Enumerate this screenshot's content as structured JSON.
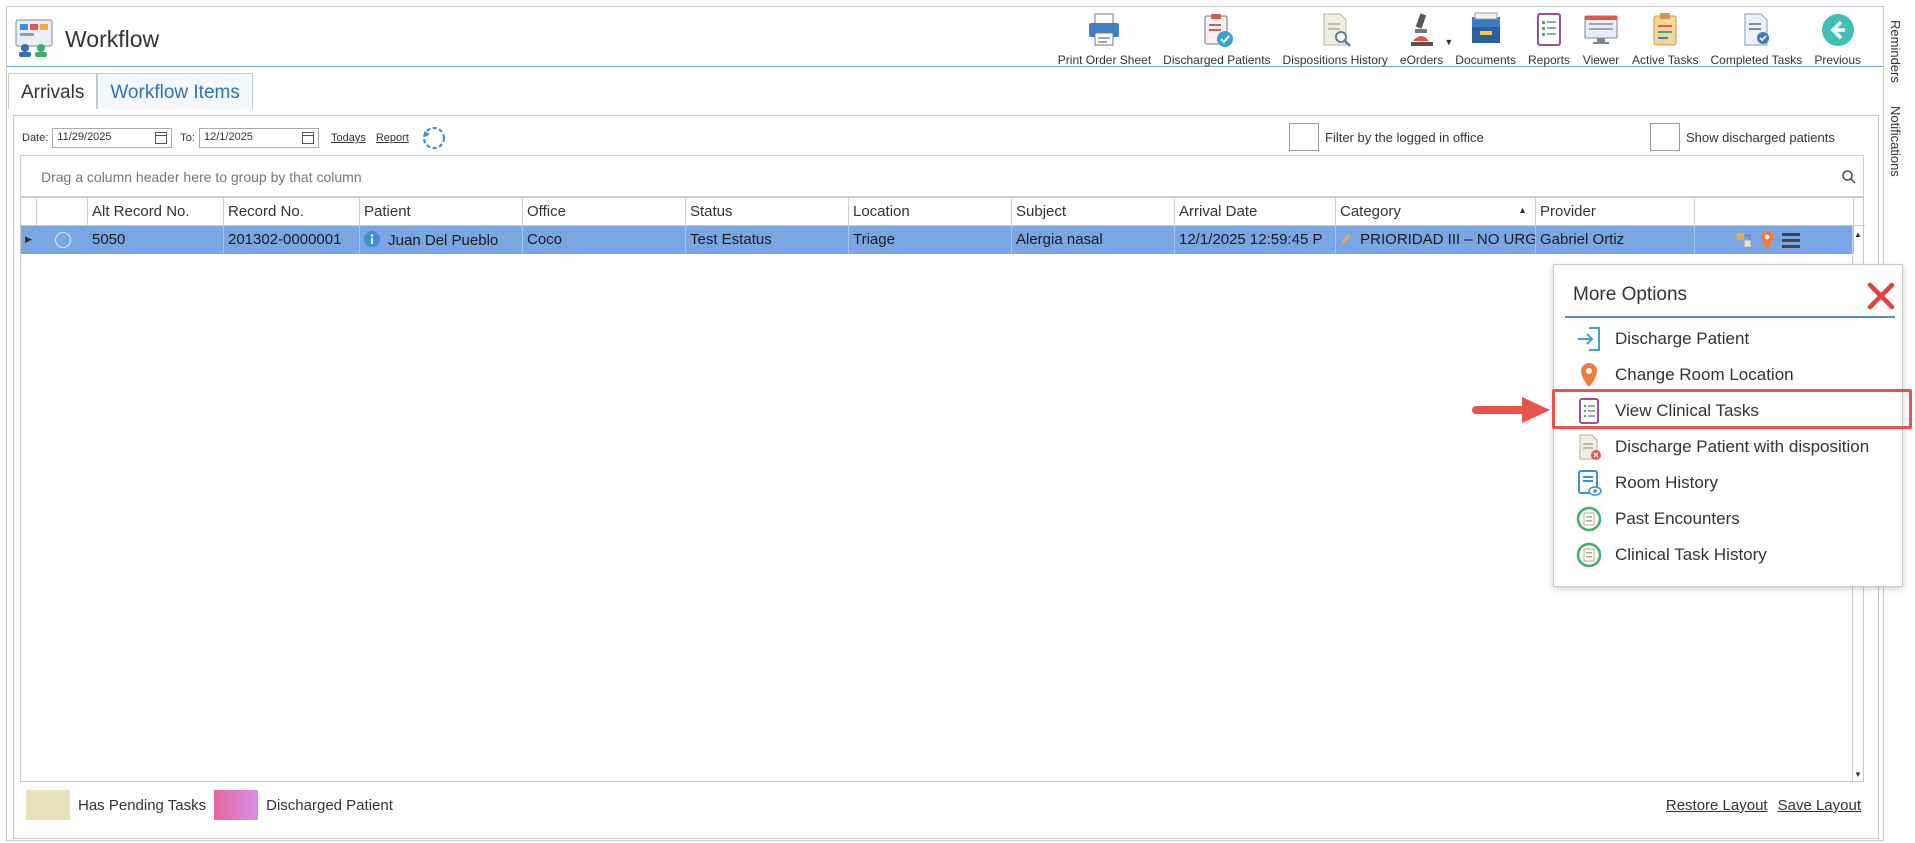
{
  "app": {
    "title": "Workflow"
  },
  "toolbar": [
    {
      "id": "print-order-sheet",
      "label": "Print Order Sheet",
      "icon": "printer-icon"
    },
    {
      "id": "discharged-patients",
      "label": "Discharged Patients",
      "icon": "clipboard-check-icon"
    },
    {
      "id": "dispositions-history",
      "label": "Dispositions History",
      "icon": "document-search-icon"
    },
    {
      "id": "eorders",
      "label": "eOrders",
      "icon": "microscope-icon"
    },
    {
      "id": "documents",
      "label": "Documents",
      "icon": "inbox-tray-icon"
    },
    {
      "id": "reports",
      "label": "Reports",
      "icon": "report-icon"
    },
    {
      "id": "viewer",
      "label": "Viewer",
      "icon": "monitor-icon"
    },
    {
      "id": "active-tasks",
      "label": "Active Tasks",
      "icon": "tasks-icon"
    },
    {
      "id": "completed-tasks",
      "label": "Completed Tasks",
      "icon": "completed-document-icon"
    },
    {
      "id": "previous",
      "label": "Previous",
      "icon": "back-arrow-icon"
    }
  ],
  "side_tabs": {
    "reminders": "Reminders",
    "notifications": "Notifications"
  },
  "tabs": {
    "arrivals": "Arrivals",
    "workflow_items": "Workflow Items"
  },
  "filters": {
    "date_label": "Date:",
    "date_from": "11/29/2025",
    "to_label": "To:",
    "date_to": "12/1/2025",
    "todays": "Todays",
    "report": "Report",
    "filter_office": "Filter by the logged in office",
    "show_discharged": "Show discharged patients"
  },
  "grid": {
    "group_hint": "Drag a column header here to group by that column",
    "columns": [
      "Alt Record No.",
      "Record No.",
      "Patient",
      "Office",
      "Status",
      "Location",
      "Subject",
      "Arrival Date",
      "Category",
      "Provider"
    ],
    "row": {
      "alt_record": "5050",
      "record": "201302-0000001",
      "patient": "Juan Del Pueblo",
      "office": "Coco",
      "status": "Test Estatus",
      "location": "Triage",
      "subject": "Alergia nasal",
      "arrival_date": "12/1/2025 12:59:45 P",
      "category": "PRIORIDAD III – NO URG",
      "provider": "Gabriel Ortiz"
    }
  },
  "legend": {
    "pending": "Has Pending Tasks",
    "discharged": "Discharged Patient",
    "pending_color": "#e8e2b8",
    "discharged_color": "#e6679f"
  },
  "layout": {
    "restore": "Restore Layout",
    "save": "Save Layout"
  },
  "popup": {
    "title": "More Options",
    "items": [
      "Discharge Patient",
      "Change Room Location",
      "View Clinical Tasks",
      "Discharge Patient with disposition",
      "Room History",
      "Past Encounters",
      "Clinical Task History"
    ]
  },
  "colors": {
    "accent": "#2e73b8",
    "row_selected": "#7aa7e3",
    "highlight": "#e8544b"
  }
}
